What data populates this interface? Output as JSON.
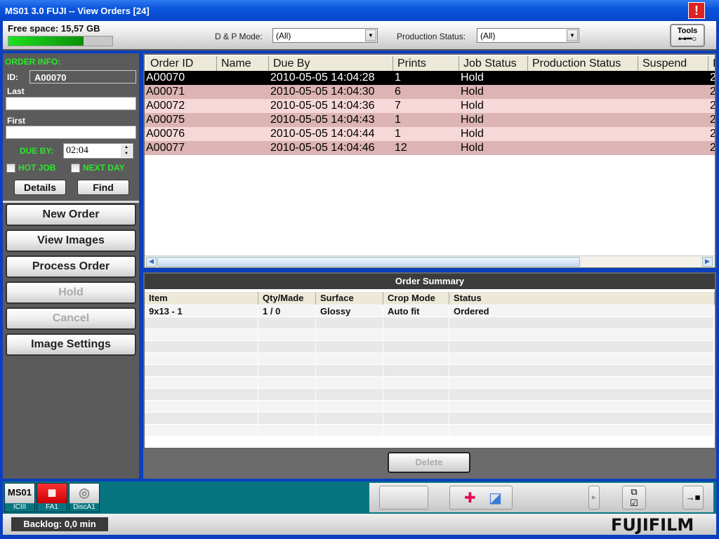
{
  "window": {
    "title": "MS01 3.0  FUJI  --  View Orders  [24]",
    "alert_icon": "exclamation-icon"
  },
  "toolbar": {
    "free_space": "Free space: 15,57 GB",
    "free_space_fraction": 0.72,
    "dp_mode_label": "D & P Mode:",
    "dp_mode_value": "(All)",
    "production_status_label": "Production Status:",
    "production_status_value": "(All)",
    "tools_label": "Tools"
  },
  "order_info": {
    "heading": "ORDER INFO:",
    "id_label": "ID:",
    "id_value": "A00070",
    "last_label": "Last",
    "last_value": "",
    "first_label": "First",
    "first_value": "",
    "due_by_label": "DUE BY:",
    "due_by_value": "02:04",
    "hot_job_label": "HOT JOB",
    "hot_job_checked": false,
    "next_day_label": "NEXT DAY",
    "next_day_checked": false,
    "details_label": "Details",
    "find_label": "Find"
  },
  "actions": [
    {
      "label": "New Order",
      "enabled": true
    },
    {
      "label": "View Images",
      "enabled": true
    },
    {
      "label": "Process Order",
      "enabled": true
    },
    {
      "label": "Hold",
      "enabled": false
    },
    {
      "label": "Cancel",
      "enabled": false
    },
    {
      "label": "Image Settings",
      "enabled": true
    }
  ],
  "orders": {
    "columns": [
      "Order ID",
      "Name",
      "Due By",
      "Prints",
      "Job Status",
      "Production Status",
      "Suspend",
      "I"
    ],
    "rows": [
      {
        "id": "A00070",
        "name": "",
        "due": "2010-05-05  14:04:28",
        "prints": "1",
        "job_status": "Hold",
        "production_status": "",
        "suspend": "",
        "last": "2",
        "selected": true
      },
      {
        "id": "A00071",
        "name": "",
        "due": "2010-05-05  14:04:30",
        "prints": "6",
        "job_status": "Hold",
        "production_status": "",
        "suspend": "",
        "last": "2"
      },
      {
        "id": "A00072",
        "name": "",
        "due": "2010-05-05  14:04:36",
        "prints": "7",
        "job_status": "Hold",
        "production_status": "",
        "suspend": "",
        "last": "2"
      },
      {
        "id": "A00075",
        "name": "",
        "due": "2010-05-05  14:04:43",
        "prints": "1",
        "job_status": "Hold",
        "production_status": "",
        "suspend": "",
        "last": "2"
      },
      {
        "id": "A00076",
        "name": "",
        "due": "2010-05-05  14:04:44",
        "prints": "1",
        "job_status": "Hold",
        "production_status": "",
        "suspend": "",
        "last": "2"
      },
      {
        "id": "A00077",
        "name": "",
        "due": "2010-05-05  14:04:46",
        "prints": "12",
        "job_status": "Hold",
        "production_status": "",
        "suspend": "",
        "last": "2"
      }
    ]
  },
  "summary": {
    "title": "Order Summary",
    "columns": [
      "Item",
      "Qty/Made",
      "Surface",
      "Crop Mode",
      "Status"
    ],
    "rows": [
      {
        "item": "9x13 - 1",
        "qty": "1 / 0",
        "surface": "Glossy",
        "crop": "Auto fit",
        "status": "Ordered"
      }
    ],
    "delete_label": "Delete"
  },
  "devices": [
    {
      "face": "MS01",
      "caption": "ICIII"
    },
    {
      "face": "",
      "caption": "FA1",
      "icon": "printer-icon"
    },
    {
      "face": "",
      "caption": "DiscA1",
      "icon": "disc-icon"
    }
  ],
  "statusbar": {
    "backlog": "Backlog: 0,0 min",
    "logo": "FUJIFILM"
  },
  "colors": {
    "selected_row": "#000000",
    "row_dark": "#dcb4b4",
    "row_light": "#f7d8d8",
    "accent_green": "#2ee62e",
    "teal": "#077580"
  }
}
